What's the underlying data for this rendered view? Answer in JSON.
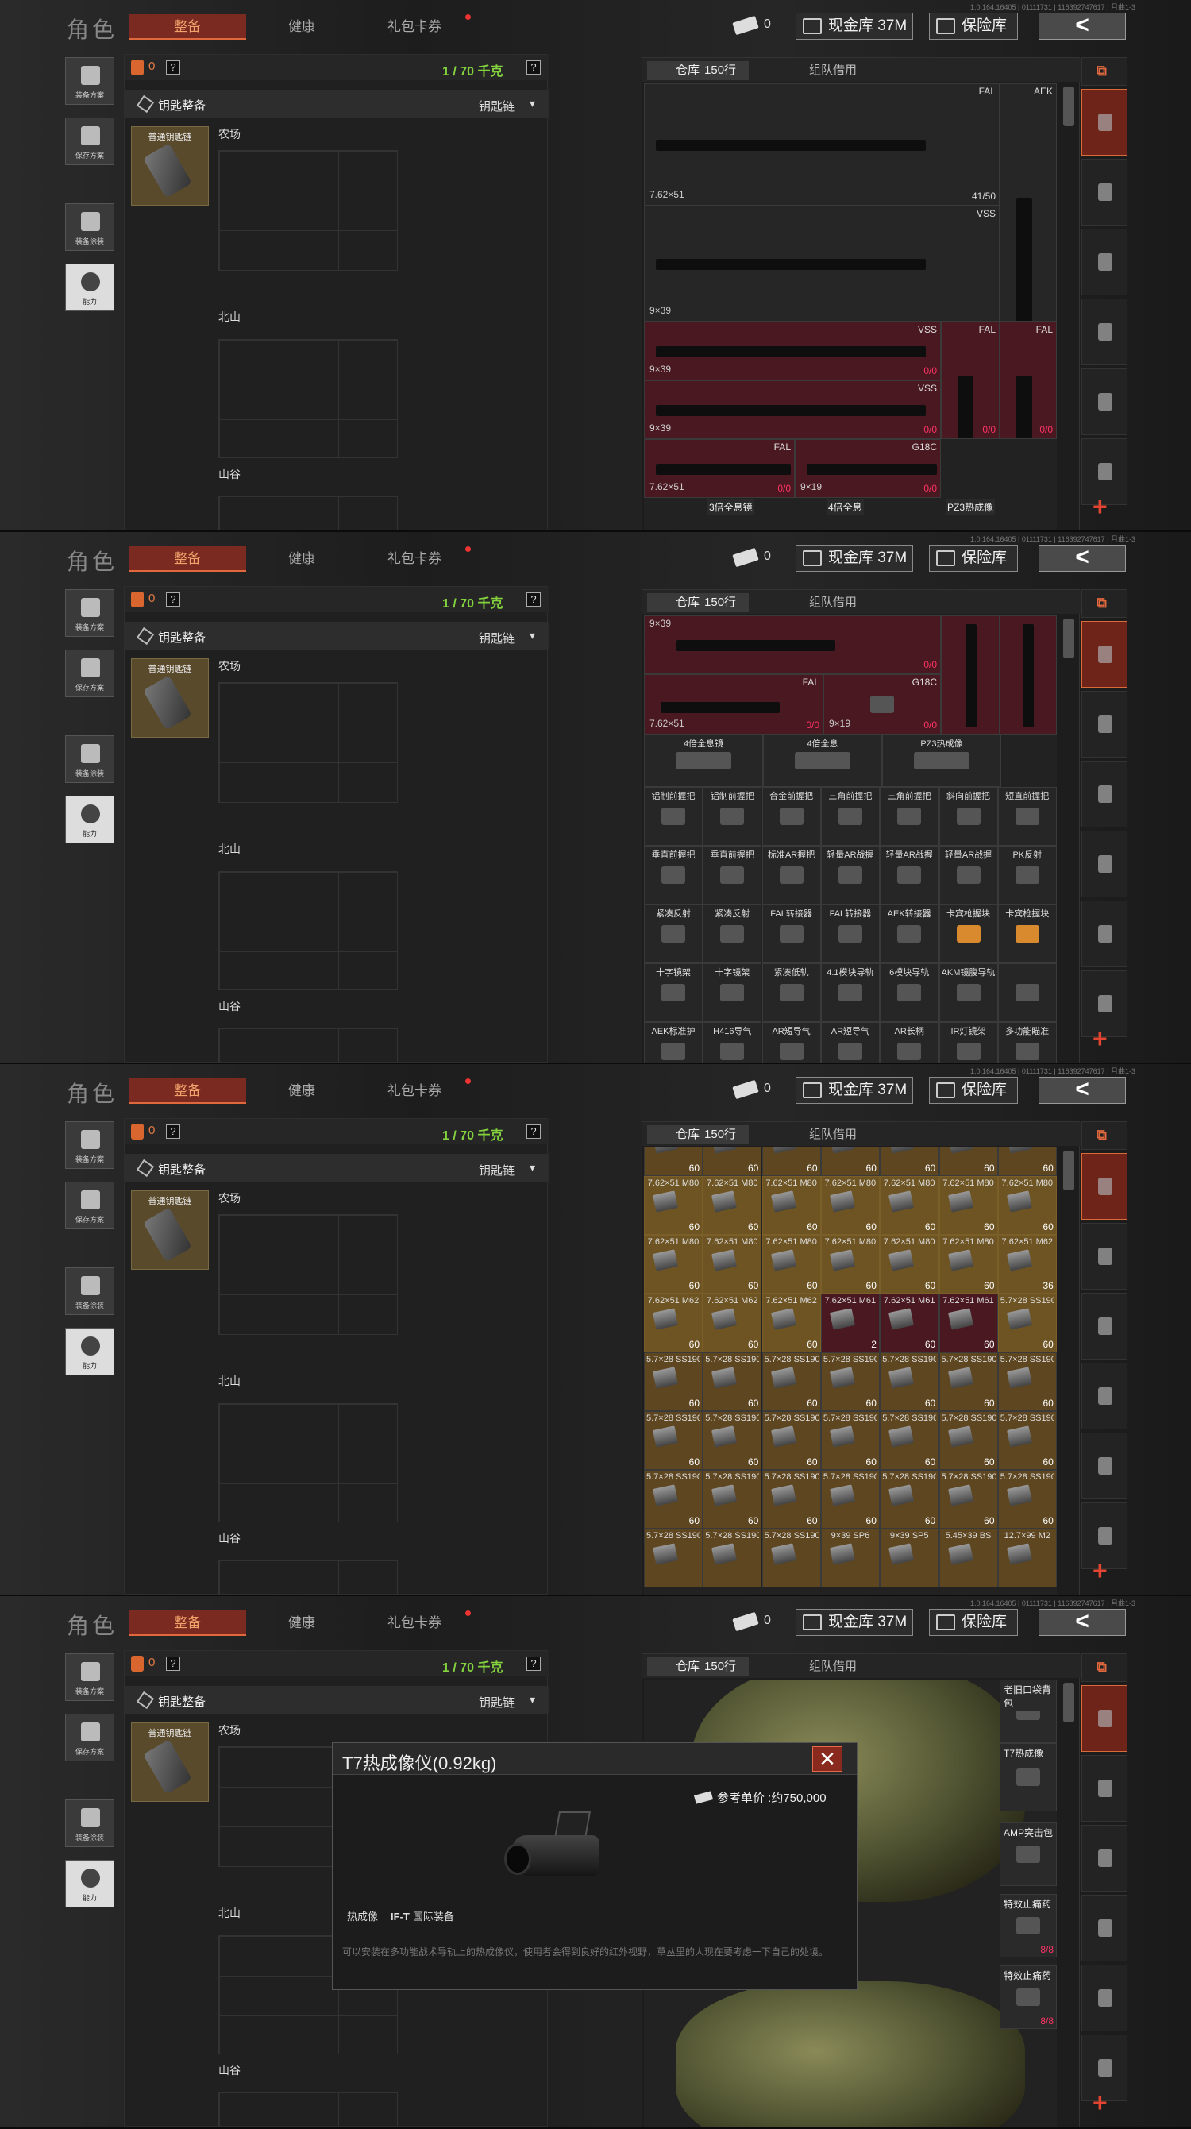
{
  "version": "1.0.164.16405 | 01111731 | 116392747617 | 月曲1-3",
  "header": {
    "title": "角色",
    "tabs": [
      {
        "label": "整备",
        "active": true
      },
      {
        "label": "健康",
        "active": false
      },
      {
        "label": "礼包卡券",
        "active": false
      }
    ],
    "voucher_count": "0",
    "cash_button": "现金库 37M",
    "vault_button": "保险库",
    "back_glyph": "<"
  },
  "left_rail": {
    "items": [
      {
        "label": "装备方案",
        "icon": "backpack-icon"
      },
      {
        "label": "保存方案",
        "icon": "save-download-icon"
      },
      {
        "label": "装备涂装",
        "icon": "helmet-icon"
      },
      {
        "label": "能力",
        "icon": "ability-icon"
      }
    ]
  },
  "loadout": {
    "armor_value": "0",
    "help": "?",
    "weight": "1 / 70 千克",
    "subheader_title": "钥匙整备",
    "subheader_right": "钥匙链",
    "chevron": "▾",
    "keycard_label": "普通钥匙链",
    "sections": [
      "农场",
      "北山",
      "山谷"
    ]
  },
  "inventory": {
    "tab_warehouse": "仓库",
    "row_count": "150行",
    "tab_team": "组队借用",
    "add": "+",
    "screen1": {
      "items": [
        {
          "name": "FAL",
          "caliber": "7.62×51",
          "count": "41/50"
        },
        {
          "name": "AEK",
          "caliber": "",
          "count": ""
        },
        {
          "name": "VSS",
          "caliber": "9×39",
          "count": ""
        },
        {
          "name": "VSS",
          "caliber": "9×39",
          "count": "0/0"
        },
        {
          "name": "FAL",
          "caliber": "",
          "count": "0/0"
        },
        {
          "name": "VSS",
          "caliber": "9×39",
          "count": "0/0"
        },
        {
          "name": "FAL",
          "caliber": "",
          "count": "0/0"
        },
        {
          "name": "FAL",
          "caliber": "7.62×51",
          "count": "0/0"
        },
        {
          "name": "G18C",
          "caliber": "9×19",
          "count": "0/0"
        }
      ],
      "peek": [
        "3倍全息镜",
        "4倍全息",
        "PZ3热成像"
      ]
    },
    "screen2": {
      "top": [
        {
          "name": "",
          "caliber": "9×39",
          "count": "0/0"
        },
        {
          "name": "FAL",
          "caliber": "7.62×51",
          "count": "0/0"
        },
        {
          "name": "G18C",
          "caliber": "9×19",
          "count": "0/0"
        }
      ],
      "scopes": [
        "4倍全息镜",
        "4倍全息",
        "PZ3热成像"
      ],
      "attachments": [
        [
          "铝制前握把",
          "铝制前握把",
          "合金前握把",
          "三角前握把",
          "三角前握把",
          "斜向前握把",
          "短直前握把"
        ],
        [
          "垂直前握把",
          "垂直前握把",
          "标准AR握把",
          "轻量AR战握",
          "轻量AR战握",
          "轻量AR战握",
          "PK反射"
        ],
        [
          "紧凑反射",
          "紧凑反射",
          "FAL转接器",
          "FAL转接器",
          "AEK转接器",
          "卡宾枪握块",
          "卡宾枪握块"
        ],
        [
          "十字镜架",
          "十字镜架",
          "紧凑低轨",
          "4.1模块导轨",
          "6模块导轨",
          "AKM镜腹导轨",
          ""
        ],
        [
          "AEK标准护",
          "H416导气",
          "AR短导气",
          "AR短导气",
          "AR长柄",
          "IR灯镜架",
          "多功能瞄准"
        ]
      ]
    },
    "screen3": {
      "ammo_rows": [
        [
          [
            "",
            "60"
          ],
          [
            "",
            "60"
          ],
          [
            "",
            "60"
          ],
          [
            "",
            "60"
          ],
          [
            "",
            "60"
          ],
          [
            "",
            "60"
          ],
          [
            "",
            "60"
          ]
        ],
        [
          [
            "7.62×51 M80",
            "60"
          ],
          [
            "7.62×51 M80",
            "60"
          ],
          [
            "7.62×51 M80",
            "60"
          ],
          [
            "7.62×51 M80",
            "60"
          ],
          [
            "7.62×51 M80",
            "60"
          ],
          [
            "7.62×51 M80",
            "60"
          ],
          [
            "7.62×51 M80",
            "60"
          ]
        ],
        [
          [
            "7.62×51 M80",
            "60"
          ],
          [
            "7.62×51 M80",
            "60"
          ],
          [
            "7.62×51 M80",
            "60"
          ],
          [
            "7.62×51 M80",
            "60"
          ],
          [
            "7.62×51 M80",
            "60"
          ],
          [
            "7.62×51 M80",
            "60"
          ],
          [
            "7.62×51 M62",
            "36"
          ]
        ],
        [
          [
            "7.62×51 M62",
            "60"
          ],
          [
            "7.62×51 M62",
            "60"
          ],
          [
            "7.62×51 M62",
            "60"
          ],
          [
            "7.62×51 M61",
            "2"
          ],
          [
            "7.62×51 M61",
            "60"
          ],
          [
            "7.62×51 M61",
            "60"
          ],
          [
            "5.7×28 SS190",
            "60"
          ]
        ],
        [
          [
            "5.7×28 SS190",
            "60"
          ],
          [
            "5.7×28 SS190",
            "60"
          ],
          [
            "5.7×28 SS190",
            "60"
          ],
          [
            "5.7×28 SS190",
            "60"
          ],
          [
            "5.7×28 SS190",
            "60"
          ],
          [
            "5.7×28 SS190",
            "60"
          ],
          [
            "5.7×28 SS190",
            "60"
          ]
        ],
        [
          [
            "5.7×28 SS190",
            "60"
          ],
          [
            "5.7×28 SS190",
            "60"
          ],
          [
            "5.7×28 SS190",
            "60"
          ],
          [
            "5.7×28 SS190",
            "60"
          ],
          [
            "5.7×28 SS190",
            "60"
          ],
          [
            "5.7×28 SS190",
            "60"
          ],
          [
            "5.7×28 SS190",
            "60"
          ]
        ],
        [
          [
            "5.7×28 SS190",
            "60"
          ],
          [
            "5.7×28 SS190",
            "60"
          ],
          [
            "5.7×28 SS190",
            "60"
          ],
          [
            "5.7×28 SS190",
            "60"
          ],
          [
            "5.7×28 SS190",
            "60"
          ],
          [
            "5.7×28 SS190",
            "60"
          ],
          [
            "5.7×28 SS190",
            "60"
          ]
        ],
        [
          [
            "5.7×28 SS190",
            ""
          ],
          [
            "5.7×28 SS190",
            ""
          ],
          [
            "5.7×28 SS190",
            ""
          ],
          [
            "9×39 SP6",
            ""
          ],
          [
            "9×39 SP5",
            ""
          ],
          [
            "5.45×39 BS",
            ""
          ],
          [
            "12.7×99 M2",
            ""
          ]
        ]
      ]
    },
    "screen4": {
      "side_items": [
        "老旧口袋背包",
        "T7热成像",
        "AMP突击包",
        "特效止痛药",
        "特效止痛药"
      ],
      "side_counts": [
        "8/8",
        "8/8"
      ]
    }
  },
  "tooltip": {
    "title": "T7热成像仪(0.92kg)",
    "close": "✕",
    "price": "参考单价 :约750,000",
    "tags": [
      "热成像",
      "国际装备"
    ],
    "tag_prefix": "IF-T",
    "description": "可以安装在多功能战术导轨上的热成像仪，使用者会得到良好的红外视野，草丛里的人现在要考虑一下自己的处境。"
  },
  "colors": {
    "accent": "#e0683c",
    "active_tab": "#7a2a20",
    "weight": "#83d23e",
    "empty_red": "#4a1820",
    "ammo_gold": "#6e5422"
  }
}
